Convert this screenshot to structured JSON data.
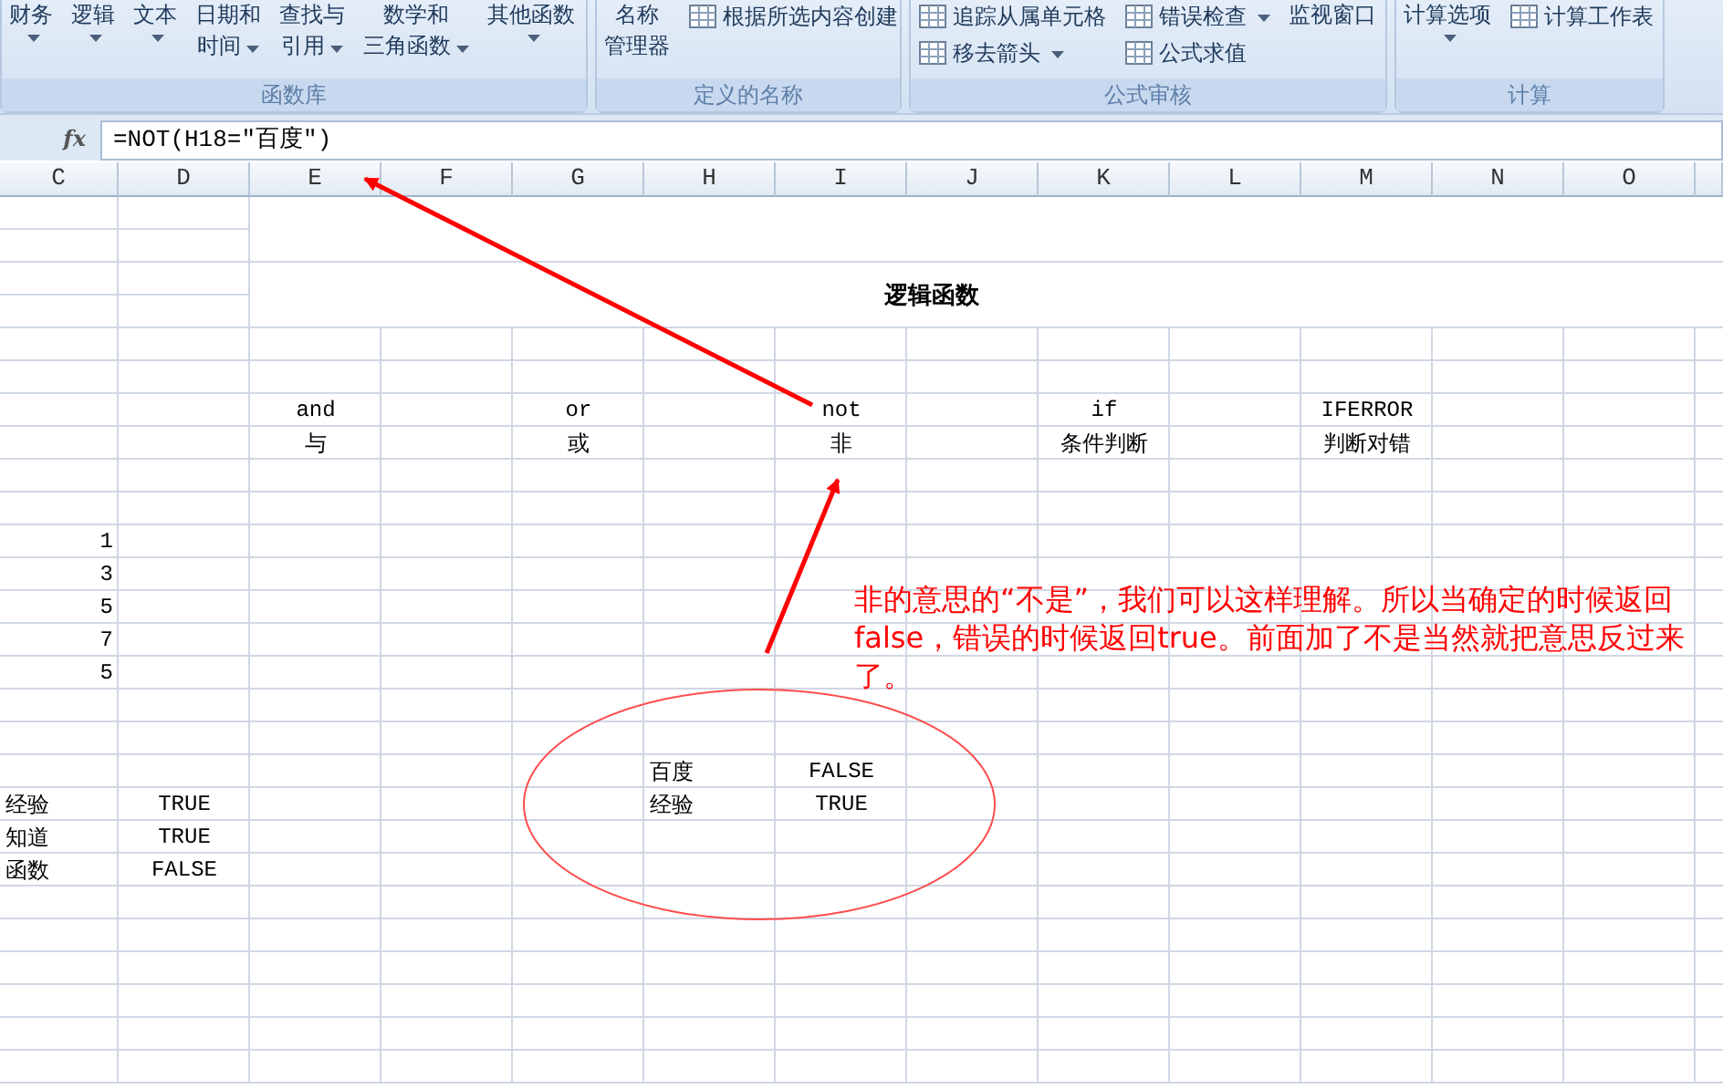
{
  "ribbon": {
    "groups": [
      {
        "label": "函数库",
        "columns": [
          {
            "kind": "large",
            "lines": [
              "财务"
            ],
            "dropdown": true
          },
          {
            "kind": "large",
            "lines": [
              "逻辑"
            ],
            "dropdown": true
          },
          {
            "kind": "large",
            "lines": [
              "文本"
            ],
            "dropdown": true
          },
          {
            "kind": "large",
            "lines": [
              "日期和",
              "时间"
            ],
            "dropdown": true
          },
          {
            "kind": "large",
            "lines": [
              "查找与",
              "引用"
            ],
            "dropdown": true
          },
          {
            "kind": "large",
            "lines": [
              "数学和",
              "三角函数"
            ],
            "dropdown": true
          },
          {
            "kind": "large",
            "lines": [
              "其他函数"
            ],
            "dropdown": true
          }
        ]
      },
      {
        "label": "定义的名称",
        "columns": [
          {
            "kind": "large",
            "lines": [
              "名称",
              "管理器"
            ],
            "dropdown": false
          },
          {
            "kind": "stack",
            "items": [
              {
                "label": "根据所选内容创建",
                "dropdown": false
              }
            ]
          }
        ]
      },
      {
        "label": "公式审核",
        "columns": [
          {
            "kind": "stack",
            "items": [
              {
                "label": "追踪从属单元格",
                "dropdown": false
              },
              {
                "label": "移去箭头",
                "dropdown": true
              }
            ]
          },
          {
            "kind": "stack",
            "items": [
              {
                "label": "错误检查",
                "dropdown": true
              },
              {
                "label": "公式求值",
                "dropdown": false
              }
            ]
          },
          {
            "kind": "large",
            "lines": [
              "监视窗口"
            ],
            "dropdown": false
          }
        ]
      },
      {
        "label": "计算",
        "columns": [
          {
            "kind": "large",
            "lines": [
              "计算选项"
            ],
            "dropdown": true
          },
          {
            "kind": "stack",
            "items": [
              {
                "label": "计算工作表",
                "dropdown": false
              }
            ]
          }
        ]
      }
    ]
  },
  "formula_bar": {
    "fx": "fx",
    "formula": "=NOT(H18=″百度″)"
  },
  "sheet": {
    "columns": [
      "C",
      "D",
      "E",
      "F",
      "G",
      "H",
      "I",
      "J",
      "K",
      "L",
      "M",
      "N",
      "O"
    ],
    "title": "逻辑函数",
    "rows": [
      {},
      {},
      {},
      {},
      {},
      {},
      {
        "cells": {
          "E": {
            "text": "and",
            "kind": "label"
          },
          "G": {
            "text": "or",
            "kind": "label"
          },
          "I": {
            "text": "not",
            "kind": "label"
          },
          "K": {
            "text": "if",
            "kind": "label"
          },
          "M": {
            "text": "IFERROR",
            "kind": "label"
          }
        }
      },
      {
        "cells": {
          "E": {
            "text": "与",
            "kind": "label"
          },
          "G": {
            "text": "或",
            "kind": "label"
          },
          "I": {
            "text": "非",
            "kind": "label"
          },
          "K": {
            "text": "条件判断",
            "kind": "label"
          },
          "M": {
            "text": "判断对错",
            "kind": "label"
          }
        }
      },
      {},
      {},
      {
        "cells": {
          "C": {
            "text": "1",
            "kind": "number"
          }
        }
      },
      {
        "cells": {
          "C": {
            "text": "3",
            "kind": "number"
          }
        }
      },
      {
        "cells": {
          "C": {
            "text": "5",
            "kind": "number"
          }
        }
      },
      {
        "cells": {
          "C": {
            "text": "7",
            "kind": "number"
          }
        }
      },
      {
        "cells": {
          "C": {
            "text": "5",
            "kind": "number"
          }
        }
      },
      {},
      {},
      {
        "cells": {
          "H": {
            "text": "百度",
            "kind": "text"
          },
          "I": {
            "text": "FALSE",
            "kind": "label"
          }
        }
      },
      {
        "cells": {
          "C": {
            "text": "经验",
            "kind": "text"
          },
          "D": {
            "text": "TRUE",
            "kind": "label"
          },
          "H": {
            "text": "经验",
            "kind": "text"
          },
          "I": {
            "text": "TRUE",
            "kind": "label"
          }
        }
      },
      {
        "cells": {
          "C": {
            "text": "知道",
            "kind": "text"
          },
          "D": {
            "text": "TRUE",
            "kind": "label"
          }
        }
      },
      {
        "cells": {
          "C": {
            "text": "函数",
            "kind": "text"
          },
          "D": {
            "text": "FALSE",
            "kind": "label"
          }
        }
      },
      {},
      {},
      {},
      {},
      {},
      {}
    ]
  },
  "annotation": {
    "text": "非的意思的“不是”，我们可以这样理解。所以当确定的时候返回false，错误的时候返回true。前面加了不是当然就把意思反过来了。"
  }
}
